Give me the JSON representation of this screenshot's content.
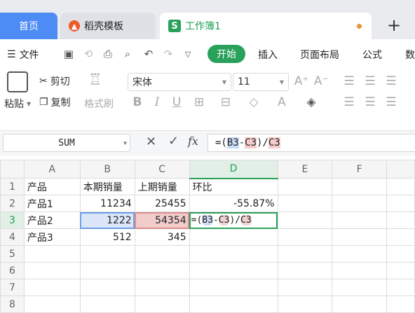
{
  "tabs": {
    "home": "首页",
    "template": "稻壳模板",
    "workbook": "工作簿1",
    "add": "+"
  },
  "menu": {
    "file": "文件",
    "start": "开始",
    "insert": "插入",
    "layout": "页面布局",
    "formula": "公式",
    "data": "数"
  },
  "ribbon": {
    "paste": "粘贴",
    "cut": "剪切",
    "copy": "复制",
    "format_painter": "格式刷",
    "font_name": "宋体",
    "font_size": "11"
  },
  "formula_bar": {
    "name_box": "SUM",
    "fx": "fx",
    "content": {
      "eq": "=(",
      "b3": "B3",
      "minus": "-",
      "c3": "C3",
      "close": ")/",
      "c3b": "C3"
    }
  },
  "sheet": {
    "columns": [
      "A",
      "B",
      "C",
      "D",
      "E",
      "F"
    ],
    "rows": [
      {
        "n": "1",
        "a": "产品",
        "b": "本期销量",
        "c": "上期销量",
        "d": "环比"
      },
      {
        "n": "2",
        "a": "产品1",
        "b": "11234",
        "c": "25455",
        "d": "-55.87%"
      },
      {
        "n": "3",
        "a": "产品2",
        "b": "1222",
        "c": "54354",
        "d": ""
      },
      {
        "n": "4",
        "a": "产品3",
        "b": "512",
        "c": "345",
        "d": ""
      },
      {
        "n": "5",
        "a": "",
        "b": "",
        "c": "",
        "d": ""
      },
      {
        "n": "6",
        "a": "",
        "b": "",
        "c": "",
        "d": ""
      },
      {
        "n": "7",
        "a": "",
        "b": "",
        "c": "",
        "d": ""
      },
      {
        "n": "8",
        "a": "",
        "b": "",
        "c": "",
        "d": ""
      }
    ],
    "cell_formula": {
      "eq": "=(",
      "b3": "B3",
      "minus": "-",
      "c3": "C3",
      "close": ")/",
      "c3b": "C3"
    }
  },
  "colors": {
    "accent": "#2aa15a",
    "tab_blue": "#4d8bf5",
    "ref_blue": "#c9dbf6",
    "ref_red": "#f4cccc"
  }
}
